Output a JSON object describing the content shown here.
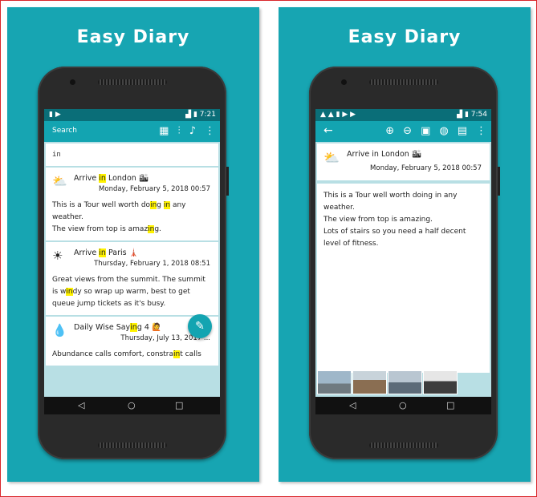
{
  "app_name": "Easy Diary",
  "left_screen": {
    "status": {
      "left_icons": "▮ ▶",
      "time": "7:21"
    },
    "toolbar": {
      "search_label": "Search",
      "icons": [
        "calendar-icon",
        "sliders-icon",
        "mic-icon",
        "more-icon"
      ]
    },
    "search_query": "in",
    "entries": [
      {
        "weather": "partly-cloudy",
        "title_pre": "Arrive ",
        "title_hl": "in",
        "title_post": " London",
        "title_emoji": "🏙",
        "date": "Monday, February 5, 2018 00:57",
        "body": [
          "This is a Tour well worth do",
          "in",
          "g ",
          "in",
          " any",
          "weather.",
          "The view from top is amaz",
          "in",
          "g."
        ]
      },
      {
        "weather": "sunny",
        "title_pre": "Arrive ",
        "title_hl": "in",
        "title_post": "  Paris",
        "title_emoji": "🗼",
        "date": "Thursday, February 1, 2018 08:51",
        "body": [
          "Great views from the summit. The summit is w",
          "in",
          "dy so wrap up warm, best to get queue jump tickets as it's busy."
        ]
      },
      {
        "weather": "rain",
        "title_pre": "Daily Wise Say",
        "title_hl": "in",
        "title_post": "g 4",
        "title_emoji": "🙋",
        "date": "Thursday, July 13, 2017 ...",
        "body": [
          "Abundance calls comfort, constra",
          "in",
          "t calls"
        ]
      }
    ],
    "nav": {
      "back": "◁",
      "home": "○",
      "recent": "□"
    }
  },
  "right_screen": {
    "status": {
      "left_icons": "▲ ▲ ▮ ▶ ▶",
      "time": "7:54"
    },
    "toolbar": {
      "icons": [
        "back-arrow-icon",
        "zoom-in-icon",
        "zoom-out-icon",
        "save-icon",
        "globe-icon",
        "image-icon",
        "more-icon"
      ]
    },
    "entry": {
      "weather": "partly-cloudy",
      "title": "Arrive in London",
      "title_emoji": "🏙",
      "date": "Monday, February 5, 2018 00:57",
      "body": [
        "This is a Tour well worth doing in any weather.",
        "The view from top is amazing.",
        "Lots of stairs so you need a half decent level of fitness."
      ]
    },
    "photos": [
      "london-eye-photo",
      "big-ben-photo",
      "bridge-photo",
      "tower-bridge-photo"
    ],
    "nav": {
      "back": "◁",
      "home": "○",
      "recent": "□"
    }
  },
  "colors": {
    "brand_bg": "#17a5b2",
    "toolbar": "#13a4b1",
    "statusbar": "#0a6e78",
    "highlight": "#fff200",
    "content_bg": "#b8dfe4"
  }
}
